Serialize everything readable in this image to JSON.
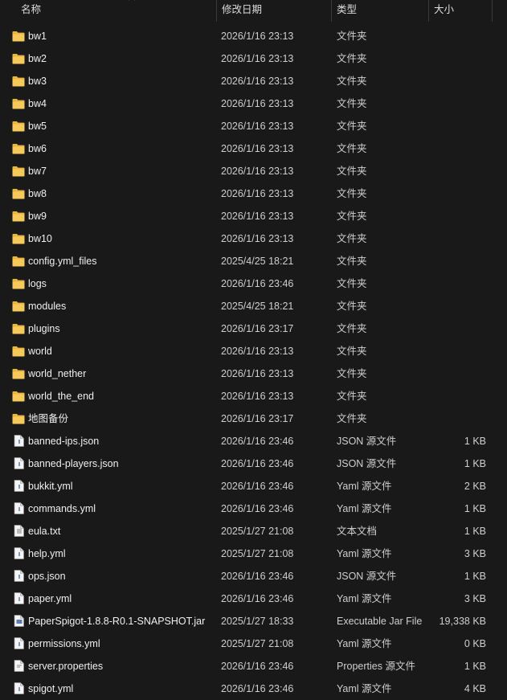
{
  "columns": {
    "name": "名称",
    "date": "修改日期",
    "type": "类型",
    "size": "大小"
  },
  "colors": {
    "background": "#191919",
    "folder": "#f2c14e",
    "text": "#f0f0f0"
  },
  "files": [
    {
      "name": "bw1",
      "date": "2026/1/16 23:13",
      "type": "文件夹",
      "size": "",
      "icon": "folder-icon"
    },
    {
      "name": "bw2",
      "date": "2026/1/16 23:13",
      "type": "文件夹",
      "size": "",
      "icon": "folder-icon"
    },
    {
      "name": "bw3",
      "date": "2026/1/16 23:13",
      "type": "文件夹",
      "size": "",
      "icon": "folder-icon"
    },
    {
      "name": "bw4",
      "date": "2026/1/16 23:13",
      "type": "文件夹",
      "size": "",
      "icon": "folder-icon"
    },
    {
      "name": "bw5",
      "date": "2026/1/16 23:13",
      "type": "文件夹",
      "size": "",
      "icon": "folder-icon"
    },
    {
      "name": "bw6",
      "date": "2026/1/16 23:13",
      "type": "文件夹",
      "size": "",
      "icon": "folder-icon"
    },
    {
      "name": "bw7",
      "date": "2026/1/16 23:13",
      "type": "文件夹",
      "size": "",
      "icon": "folder-icon"
    },
    {
      "name": "bw8",
      "date": "2026/1/16 23:13",
      "type": "文件夹",
      "size": "",
      "icon": "folder-icon"
    },
    {
      "name": "bw9",
      "date": "2026/1/16 23:13",
      "type": "文件夹",
      "size": "",
      "icon": "folder-icon"
    },
    {
      "name": "bw10",
      "date": "2026/1/16 23:13",
      "type": "文件夹",
      "size": "",
      "icon": "folder-icon"
    },
    {
      "name": "config.yml_files",
      "date": "2025/4/25 18:21",
      "type": "文件夹",
      "size": "",
      "icon": "folder-icon"
    },
    {
      "name": "logs",
      "date": "2026/1/16 23:46",
      "type": "文件夹",
      "size": "",
      "icon": "folder-icon"
    },
    {
      "name": "modules",
      "date": "2025/4/25 18:21",
      "type": "文件夹",
      "size": "",
      "icon": "folder-icon"
    },
    {
      "name": "plugins",
      "date": "2026/1/16 23:17",
      "type": "文件夹",
      "size": "",
      "icon": "folder-icon"
    },
    {
      "name": "world",
      "date": "2026/1/16 23:13",
      "type": "文件夹",
      "size": "",
      "icon": "folder-icon"
    },
    {
      "name": "world_nether",
      "date": "2026/1/16 23:13",
      "type": "文件夹",
      "size": "",
      "icon": "folder-icon"
    },
    {
      "name": "world_the_end",
      "date": "2026/1/16 23:13",
      "type": "文件夹",
      "size": "",
      "icon": "folder-icon"
    },
    {
      "name": "地图备份",
      "date": "2026/1/16 23:17",
      "type": "文件夹",
      "size": "",
      "icon": "folder-icon"
    },
    {
      "name": "banned-ips.json",
      "date": "2026/1/16 23:46",
      "type": "JSON 源文件",
      "size": "1 KB",
      "icon": "json-file-icon"
    },
    {
      "name": "banned-players.json",
      "date": "2026/1/16 23:46",
      "type": "JSON 源文件",
      "size": "1 KB",
      "icon": "json-file-icon"
    },
    {
      "name": "bukkit.yml",
      "date": "2026/1/16 23:46",
      "type": "Yaml 源文件",
      "size": "2 KB",
      "icon": "yaml-file-icon"
    },
    {
      "name": "commands.yml",
      "date": "2026/1/16 23:46",
      "type": "Yaml 源文件",
      "size": "1 KB",
      "icon": "yaml-file-icon"
    },
    {
      "name": "eula.txt",
      "date": "2025/1/27 21:08",
      "type": "文本文档",
      "size": "1 KB",
      "icon": "text-file-icon"
    },
    {
      "name": "help.yml",
      "date": "2025/1/27 21:08",
      "type": "Yaml 源文件",
      "size": "3 KB",
      "icon": "yaml-file-icon"
    },
    {
      "name": "ops.json",
      "date": "2026/1/16 23:46",
      "type": "JSON 源文件",
      "size": "1 KB",
      "icon": "json-file-icon"
    },
    {
      "name": "paper.yml",
      "date": "2026/1/16 23:46",
      "type": "Yaml 源文件",
      "size": "3 KB",
      "icon": "yaml-file-icon"
    },
    {
      "name": "PaperSpigot-1.8.8-R0.1-SNAPSHOT.jar",
      "date": "2025/1/27 18:33",
      "type": "Executable Jar File",
      "size": "19,338 KB",
      "icon": "jar-file-icon"
    },
    {
      "name": "permissions.yml",
      "date": "2025/1/27 21:08",
      "type": "Yaml 源文件",
      "size": "0 KB",
      "icon": "yaml-file-icon"
    },
    {
      "name": "server.properties",
      "date": "2026/1/16 23:46",
      "type": "Properties 源文件",
      "size": "1 KB",
      "icon": "properties-file-icon"
    },
    {
      "name": "spigot.yml",
      "date": "2026/1/16 23:46",
      "type": "Yaml 源文件",
      "size": "4 KB",
      "icon": "yaml-file-icon"
    }
  ]
}
